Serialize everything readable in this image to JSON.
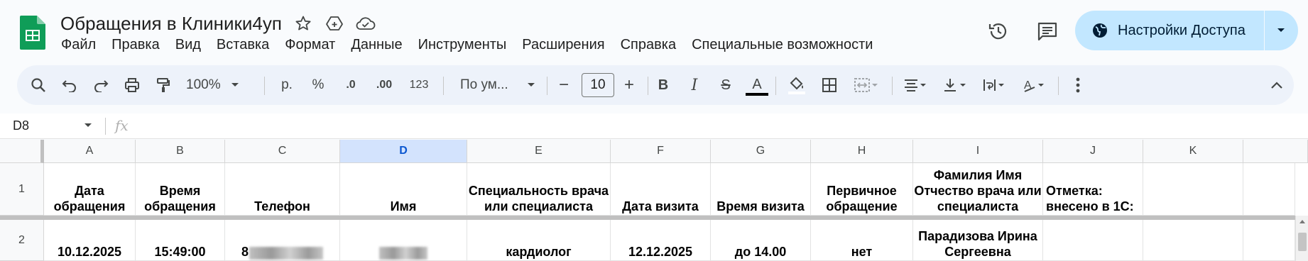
{
  "app": {
    "doc_title": "Обращения в Клиники4уп",
    "menu": [
      "Файл",
      "Правка",
      "Вид",
      "Вставка",
      "Формат",
      "Данные",
      "Инструменты",
      "Расширения",
      "Справка",
      "Специальные возможности"
    ],
    "share_label": "Настройки Доступа",
    "accent": "#c2e7ff",
    "brand": "#0f9d58"
  },
  "toolbar": {
    "zoom": "100%",
    "currency": "р.",
    "percent": "%",
    "dec_minus": ".0",
    "dec_plus": ".00",
    "number_format": "123",
    "font": "По ум...",
    "font_size": "10",
    "minus": "−",
    "plus": "+",
    "bold": "B",
    "italic": "I",
    "strike": "S",
    "text_color_letter": "A"
  },
  "formula_bar": {
    "name_box": "D8",
    "fx": "fx",
    "value": ""
  },
  "sheet": {
    "columns": [
      "A",
      "B",
      "C",
      "D",
      "E",
      "F",
      "G",
      "H",
      "I",
      "J",
      "K"
    ],
    "selected_column": "D",
    "rows": [
      {
        "num": "1",
        "cells": [
          "Дата обращения",
          "Время обращения",
          "Телефон",
          "Имя",
          "Специальность врача или специалиста",
          "Дата визита",
          "Время визита",
          "Первичное обращение",
          "Фамилия Имя Отчество врача или специалиста",
          "Отметка: внесено в 1С:",
          ""
        ]
      },
      {
        "num": "2",
        "cells": [
          "10.12.2025",
          "15:49:00",
          "8",
          "",
          "кардиолог",
          "12.12.2025",
          "до 14.00",
          "нет",
          "Парадизова Ирина Сергеевна",
          "",
          ""
        ]
      }
    ]
  }
}
